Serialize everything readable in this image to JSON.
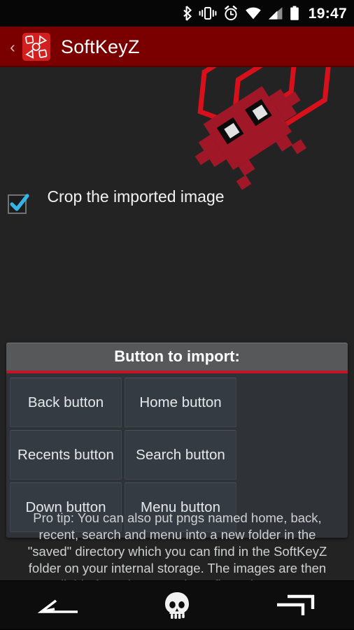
{
  "statusbar": {
    "time": "19:47",
    "icons": [
      "bluetooth-icon",
      "vibrate-icon",
      "alarm-icon",
      "wifi-icon",
      "cell-signal-icon",
      "battery-icon"
    ]
  },
  "actionbar": {
    "up_caret": "‹",
    "app_icon_name": "softkeyz-app-icon",
    "title": "SoftKeyZ",
    "accent_color": "#7a0000"
  },
  "options": {
    "crop_label": "Crop the imported image",
    "crop_checked": true,
    "check_color": "#33b5e5"
  },
  "decor": {
    "name": "pixel-invader-graphic",
    "invader_color": "#a01828",
    "outline_color": "#d8101c"
  },
  "card": {
    "header": "Button to import:",
    "header_rule_color": "#c41226",
    "buttons": [
      {
        "label": "Back button",
        "name": "back-button"
      },
      {
        "label": "Home button",
        "name": "home-button"
      },
      {
        "label": "Recents button",
        "name": "recents-button"
      },
      {
        "label": "Search button",
        "name": "search-button"
      },
      {
        "label": "Down button",
        "name": "down-button"
      },
      {
        "label": "Menu button",
        "name": "menu-button"
      }
    ]
  },
  "protip": "Pro tip: You can also put pngs named home, back, recent, search and menu into a new folder in the \"saved\" directory which you can find in the SoftKeyZ folder on your internal storage. The images are then available from the \"Saved Configurations\" page.",
  "navbar": {
    "items": [
      {
        "name": "nav-back-icon",
        "label": "Back"
      },
      {
        "name": "nav-home-skull-icon",
        "label": "Home"
      },
      {
        "name": "nav-recents-icon",
        "label": "Recents"
      }
    ]
  }
}
